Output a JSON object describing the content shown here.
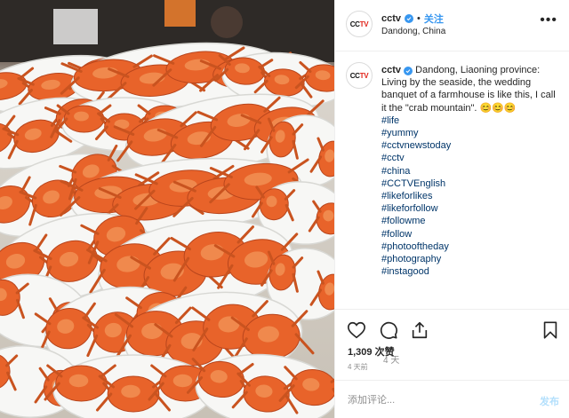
{
  "header": {
    "avatar_text_main": "CC",
    "avatar_text_accent": "TV",
    "username": "cctv",
    "separator": "•",
    "follow_label": "关注",
    "location": "Dandong, China",
    "more_label": "•••"
  },
  "caption": {
    "username": "cctv",
    "text": "Dandong, Liaoning province: Living by the seaside, the wedding banquet of a farmhouse is like this, I call it the \"crab mountain\". 😊😊😊",
    "hashtags": [
      "#life",
      "#yummy",
      "#cctvnewstoday",
      "#cctv",
      "#china",
      "#CCTVEnglish",
      "#likeforlikes",
      "#likeforfollow",
      "#followme",
      "#follow",
      "#photooftheday",
      "#photography",
      "#instagood"
    ],
    "time": "4 天"
  },
  "stats": {
    "likes": "1,309 次赞",
    "posted": "4 天前"
  },
  "comment": {
    "placeholder": "添加评论...",
    "post_label": "发布"
  },
  "icons": {
    "like": "heart-icon",
    "comment": "comment-icon",
    "share": "share-icon",
    "save": "bookmark-icon",
    "verified": "verified-badge-icon"
  },
  "colors": {
    "link": "#003569",
    "follow": "#3897f0",
    "muted": "#8e8e8e",
    "post_disabled": "#b2dffc",
    "crab": "#e8632a"
  }
}
